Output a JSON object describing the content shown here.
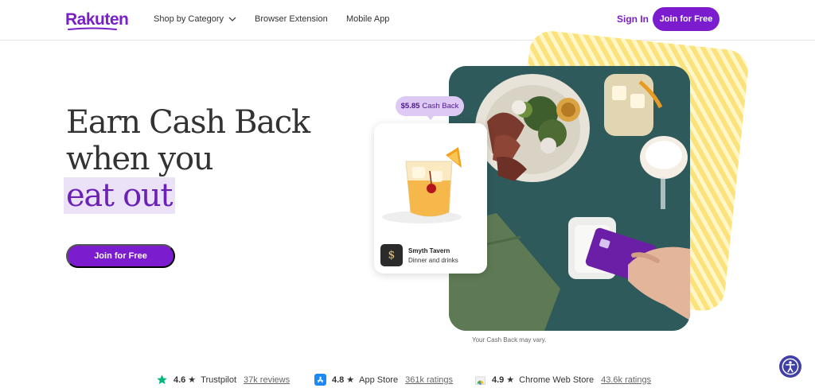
{
  "header": {
    "logo": "Rakuten",
    "nav": {
      "shop_by_category": "Shop by Category",
      "browser_extension": "Browser Extension",
      "mobile_app": "Mobile App"
    },
    "sign_in": "Sign In",
    "join_button": "Join for Free"
  },
  "hero": {
    "line1": "Earn Cash Back",
    "line2": "when you",
    "line3": "eat out",
    "cta": "Join for Free"
  },
  "promo": {
    "cashback_amount": "$5.85",
    "cashback_label": "Cash Back",
    "merchant_name": "Smyth Tavern",
    "merchant_desc": "Dinner and drinks",
    "merchant_logo_glyph": "$",
    "disclaimer": "Your Cash Back may vary."
  },
  "ratings": [
    {
      "score": "4.6",
      "star": "★",
      "source": "Trustpilot",
      "link": "37k reviews",
      "icon": "trustpilot-star-icon"
    },
    {
      "score": "4.8",
      "star": "★",
      "source": "App Store",
      "link": "361k ratings",
      "icon": "app-store-icon"
    },
    {
      "score": "4.9",
      "star": "★",
      "source": "Chrome Web Store",
      "link": "43.6k ratings",
      "icon": "chrome-web-store-icon"
    }
  ],
  "colors": {
    "brand_purple": "#7b1dce",
    "highlight_bg": "#ece2f8",
    "stripe_yellow": "#fbe27a",
    "photo_teal": "#2f5d5d"
  }
}
